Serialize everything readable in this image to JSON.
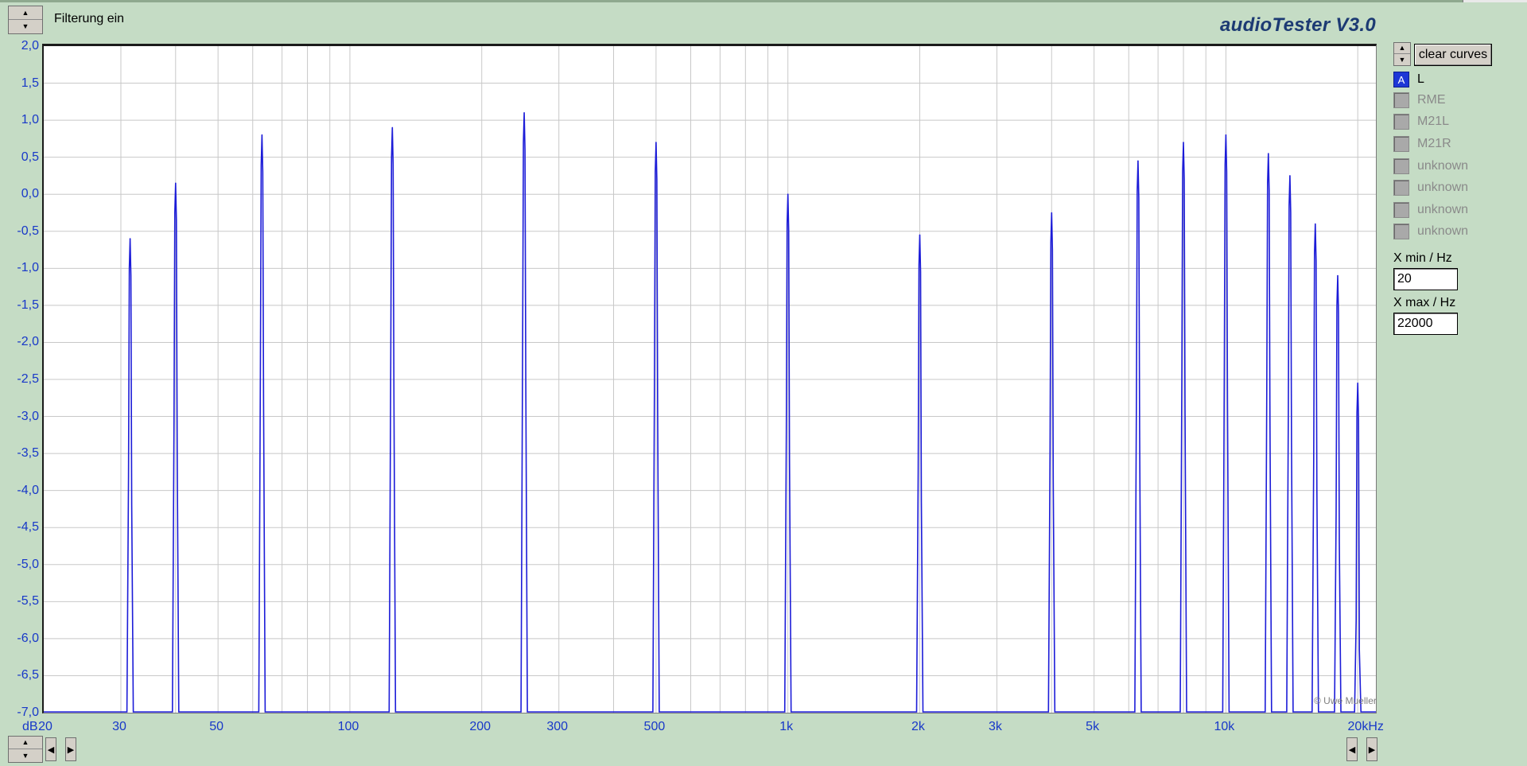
{
  "header": {
    "filter_label": "Filterung ein",
    "app_title": "audioTester  V3.0"
  },
  "sidebar": {
    "clear_curves_label": "clear curves",
    "curves": [
      {
        "badge": "A",
        "label": "L",
        "active": true
      },
      {
        "badge": "",
        "label": "RME",
        "active": false
      },
      {
        "badge": "",
        "label": "M21L",
        "active": false
      },
      {
        "badge": "",
        "label": "M21R",
        "active": false
      },
      {
        "badge": "",
        "label": "unknown",
        "active": false
      },
      {
        "badge": "",
        "label": "unknown",
        "active": false
      },
      {
        "badge": "",
        "label": "unknown",
        "active": false
      },
      {
        "badge": "",
        "label": "unknown",
        "active": false
      }
    ],
    "xmin_label": "X min / Hz",
    "xmin_value": "20",
    "xmax_label": "X max / Hz",
    "xmax_value": "22000"
  },
  "plot": {
    "watermark": "© Uwe Mueller",
    "ylabel": "dB",
    "line_color": "#1c1cd8",
    "grid_color": "#c8c8c8"
  },
  "chart_data": {
    "type": "line",
    "xscale": "log",
    "xlim": [
      20,
      22000
    ],
    "ylim": [
      -7.0,
      2.0
    ],
    "ylabel": "dB",
    "x_ticks": [
      20,
      30,
      50,
      100,
      200,
      300,
      500,
      1000,
      2000,
      3000,
      5000,
      10000,
      20000
    ],
    "x_tick_labels": [
      "20",
      "30",
      "50",
      "100",
      "200",
      "300",
      "500",
      "1k",
      "2k",
      "3k",
      "5k",
      "10k",
      "20kHz"
    ],
    "y_ticks": [
      2.0,
      1.5,
      1.0,
      0.5,
      0.0,
      -0.5,
      -1.0,
      -1.5,
      -2.0,
      -2.5,
      -3.0,
      -3.5,
      -4.0,
      -4.5,
      -5.0,
      -5.5,
      -6.0,
      -6.5,
      -7.0
    ],
    "y_tick_labels": [
      "2,0",
      "1,5",
      "1,0",
      "0,5",
      "0,0",
      "-0,5",
      "-1,0",
      "-1,5",
      "-2,0",
      "-2,5",
      "-3,0",
      "-3,5",
      "-4,0",
      "-4,5",
      "-5,0",
      "-5,5",
      "-6,0",
      "-6,5",
      "-7,0"
    ],
    "series": [
      {
        "name": "L",
        "peaks": [
          {
            "freq": 31.5,
            "level": -0.6
          },
          {
            "freq": 40,
            "level": 0.15
          },
          {
            "freq": 63,
            "level": 0.8
          },
          {
            "freq": 125,
            "level": 0.9
          },
          {
            "freq": 250,
            "level": 1.1
          },
          {
            "freq": 500,
            "level": 0.7
          },
          {
            "freq": 1000,
            "level": 0.0
          },
          {
            "freq": 2000,
            "level": -0.55
          },
          {
            "freq": 4000,
            "level": -0.25
          },
          {
            "freq": 6300,
            "level": 0.45
          },
          {
            "freq": 8000,
            "level": 0.7
          },
          {
            "freq": 10000,
            "level": 0.8
          },
          {
            "freq": 12500,
            "level": 0.55
          },
          {
            "freq": 14000,
            "level": 0.25
          },
          {
            "freq": 16000,
            "level": -0.4
          },
          {
            "freq": 18000,
            "level": -1.1
          },
          {
            "freq": 20000,
            "level": -2.55
          }
        ]
      }
    ]
  }
}
